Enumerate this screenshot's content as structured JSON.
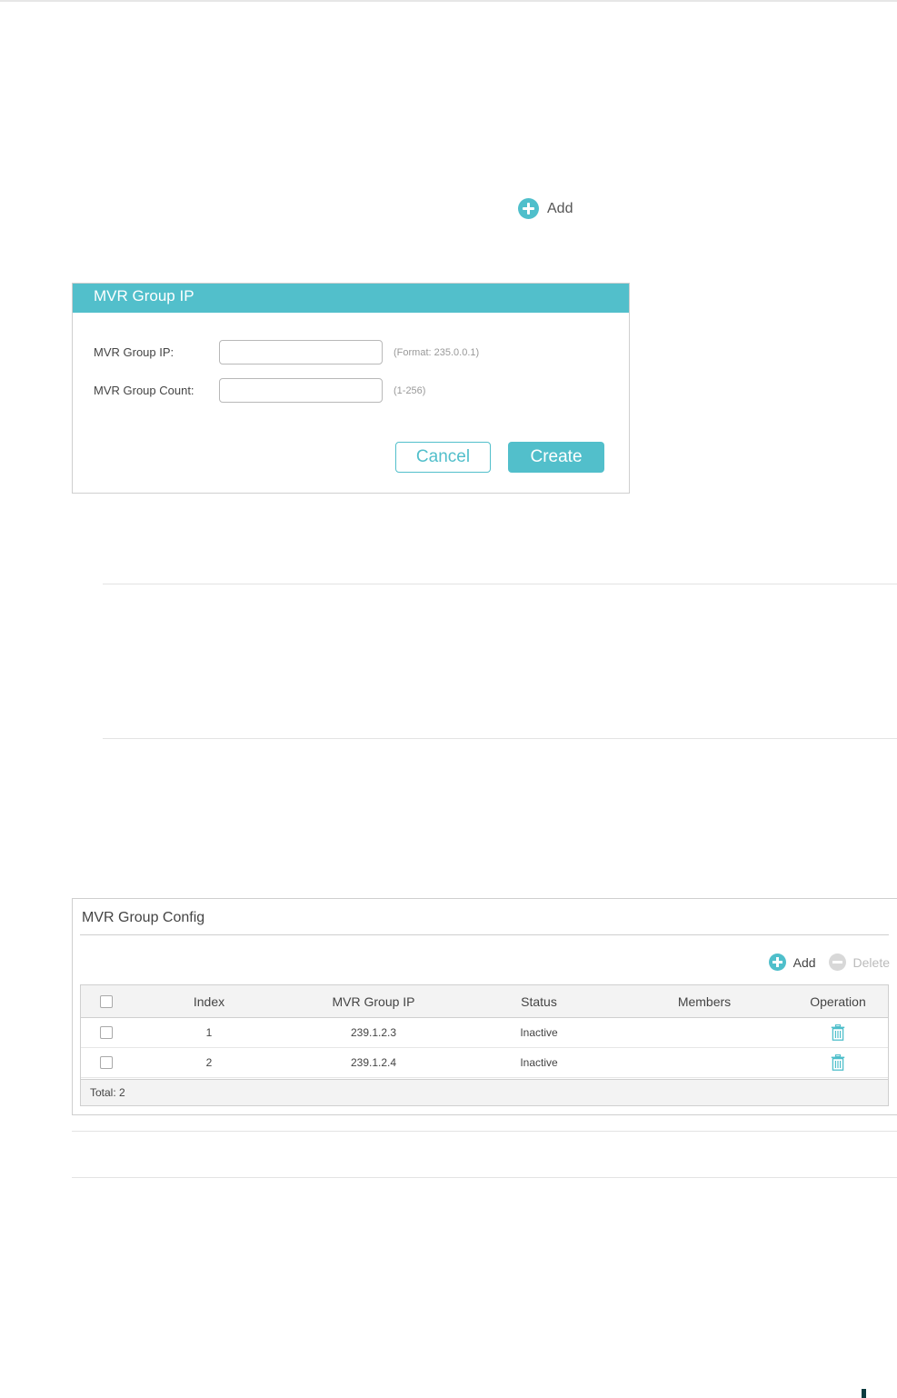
{
  "top_add_button": {
    "label": "Add"
  },
  "dialog": {
    "title": "MVR Group IP",
    "fields": [
      {
        "label": "MVR Group IP:",
        "value": "",
        "hint": "(Format: 235.0.0.1)"
      },
      {
        "label": "MVR Group Count:",
        "value": "",
        "hint": "(1-256)"
      }
    ],
    "cancel_label": "Cancel",
    "create_label": "Create"
  },
  "config": {
    "title": "MVR Group Config",
    "add_label": "Add",
    "delete_label": "Delete",
    "columns": [
      "Index",
      "MVR Group IP",
      "Status",
      "Members",
      "Operation"
    ],
    "rows": [
      {
        "index": "1",
        "ip": "239.1.2.3",
        "status": "Inactive",
        "members": ""
      },
      {
        "index": "2",
        "ip": "239.1.2.4",
        "status": "Inactive",
        "members": ""
      }
    ],
    "total": "Total: 2"
  },
  "colors": {
    "accent": "#52bfcb",
    "border": "#cfcfcf",
    "disabled": "#d8d8d8"
  }
}
